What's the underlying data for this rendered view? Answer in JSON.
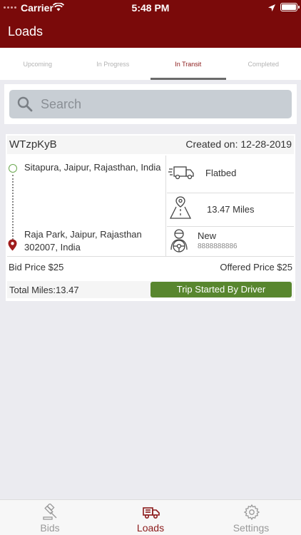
{
  "status_bar": {
    "carrier": "Carrier",
    "time": "5:48 PM"
  },
  "nav": {
    "title": "Loads"
  },
  "tabs": [
    {
      "label": "Upcoming"
    },
    {
      "label": "In Progress"
    },
    {
      "label": "In Transit"
    },
    {
      "label": "Completed"
    }
  ],
  "search": {
    "placeholder": "Search"
  },
  "load": {
    "code": "WTzpKyB",
    "created": "Created on: 12-28-2019",
    "origin": "Sitapura, Jaipur, Rajasthan, India",
    "destination": "Raja Park, Jaipur, Rajasthan 302007, India",
    "truck_type": "Flatbed",
    "distance": "13.47 Miles",
    "driver_name": "New",
    "driver_phone": "8888888886",
    "bid_price": "Bid Price $25",
    "offered_price": "Offered Price $25",
    "total_miles": "Total Miles:13.47",
    "status": "Trip Started By Driver"
  },
  "tabbar": [
    {
      "label": "Bids"
    },
    {
      "label": "Loads"
    },
    {
      "label": "Settings"
    }
  ],
  "colors": {
    "primary": "#7a0a0a",
    "accent": "#8b1a1a",
    "status_green": "#58862e"
  }
}
